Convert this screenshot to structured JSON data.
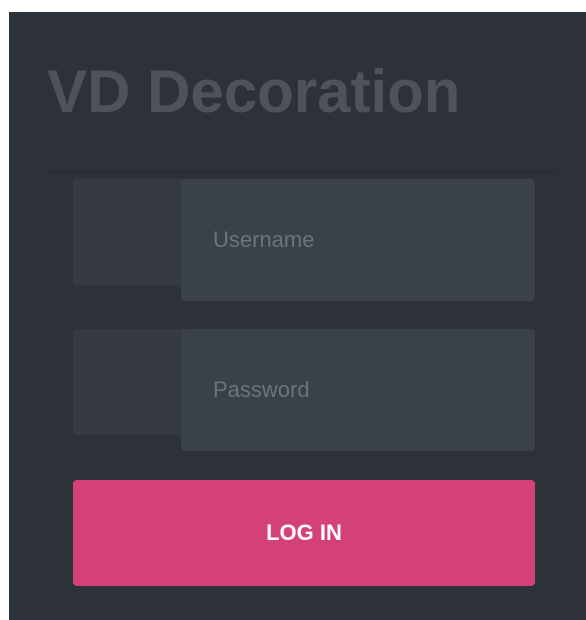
{
  "brand": {
    "title": "VD Decoration"
  },
  "login_form": {
    "username": {
      "placeholder": "Username",
      "value": "",
      "icon": "user-icon"
    },
    "password": {
      "placeholder": "Password",
      "value": "",
      "icon": "lock-icon"
    },
    "submit_label": "LOG IN"
  },
  "colors": {
    "panel_background": "#2d3238",
    "input_background": "#3b4148",
    "addon_background": "#353b41",
    "title_color": "#4e5359",
    "accent": "#d44179",
    "button_text": "#ffffff"
  }
}
